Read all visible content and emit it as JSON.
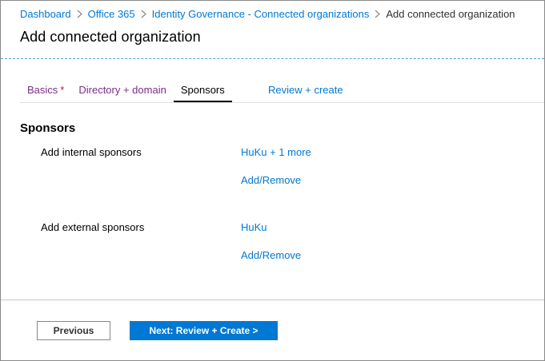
{
  "breadcrumb": {
    "items": [
      "Dashboard",
      "Office 365",
      "Identity Governance - Connected organizations"
    ],
    "current": "Add connected organization"
  },
  "page": {
    "title": "Add connected organization"
  },
  "tabs": [
    {
      "label": "Basics",
      "required_marker": "*",
      "state": "visited"
    },
    {
      "label": "Directory + domain",
      "state": "visited"
    },
    {
      "label": "Sponsors",
      "state": "active"
    },
    {
      "label": "Review + create",
      "state": "link"
    }
  ],
  "section": {
    "title": "Sponsors",
    "internal": {
      "label": "Add internal sponsors",
      "value": "HuKu + 1 more",
      "action": "Add/Remove"
    },
    "external": {
      "label": "Add external sponsors",
      "value": "HuKu",
      "action": "Add/Remove"
    }
  },
  "footer": {
    "previous_label": "Previous",
    "next_label": "Next: Review + Create >"
  },
  "colors": {
    "accent": "#0078d4",
    "visited_link": "#7b2c8a",
    "required": "#a4262c"
  }
}
